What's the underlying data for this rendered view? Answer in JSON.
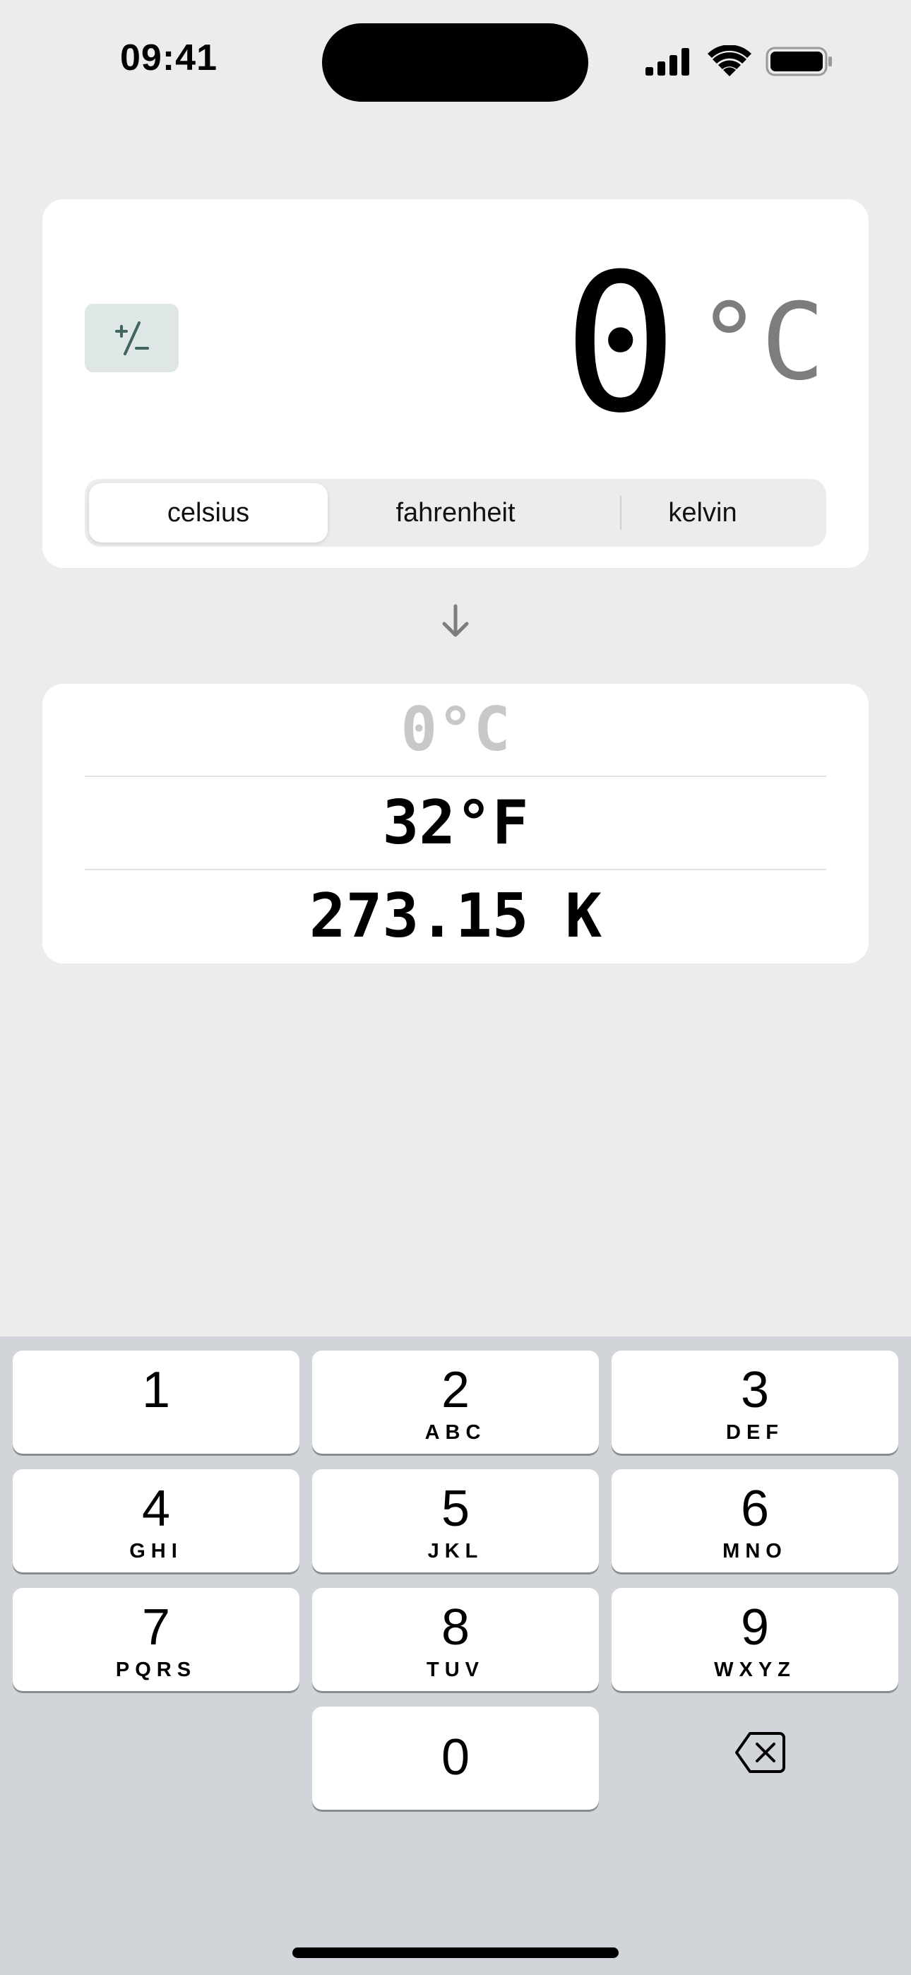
{
  "status_bar": {
    "time": "09:41",
    "icons": [
      "cellular-signal-icon",
      "wifi-icon",
      "battery-icon"
    ]
  },
  "input": {
    "sign_toggle_label": "+/−",
    "value": "0",
    "unit": "°C"
  },
  "units_segmented": {
    "options": [
      "celsius",
      "fahrenheit",
      "kelvin"
    ],
    "selected": "celsius"
  },
  "results": [
    {
      "text": "0°C",
      "dimmed": true
    },
    {
      "text": "32°F",
      "dimmed": false
    },
    {
      "text": "273.15 K",
      "dimmed": false
    }
  ],
  "keypad": {
    "keys": [
      {
        "digit": "1",
        "letters": ""
      },
      {
        "digit": "2",
        "letters": "ABC"
      },
      {
        "digit": "3",
        "letters": "DEF"
      },
      {
        "digit": "4",
        "letters": "GHI"
      },
      {
        "digit": "5",
        "letters": "JKL"
      },
      {
        "digit": "6",
        "letters": "MNO"
      },
      {
        "digit": "7",
        "letters": "PQRS"
      },
      {
        "digit": "8",
        "letters": "TUV"
      },
      {
        "digit": "9",
        "letters": "WXYZ"
      },
      {
        "digit": "0",
        "letters": ""
      }
    ],
    "backspace_icon": "backspace-icon"
  },
  "colors": {
    "background": "#ececec",
    "card": "#ffffff",
    "sign_button": "#dfe6e6",
    "unit_gray": "#7d7d7d",
    "dimmed_result": "#c8c8c8",
    "keypad_bg": "#d1d4d9"
  }
}
